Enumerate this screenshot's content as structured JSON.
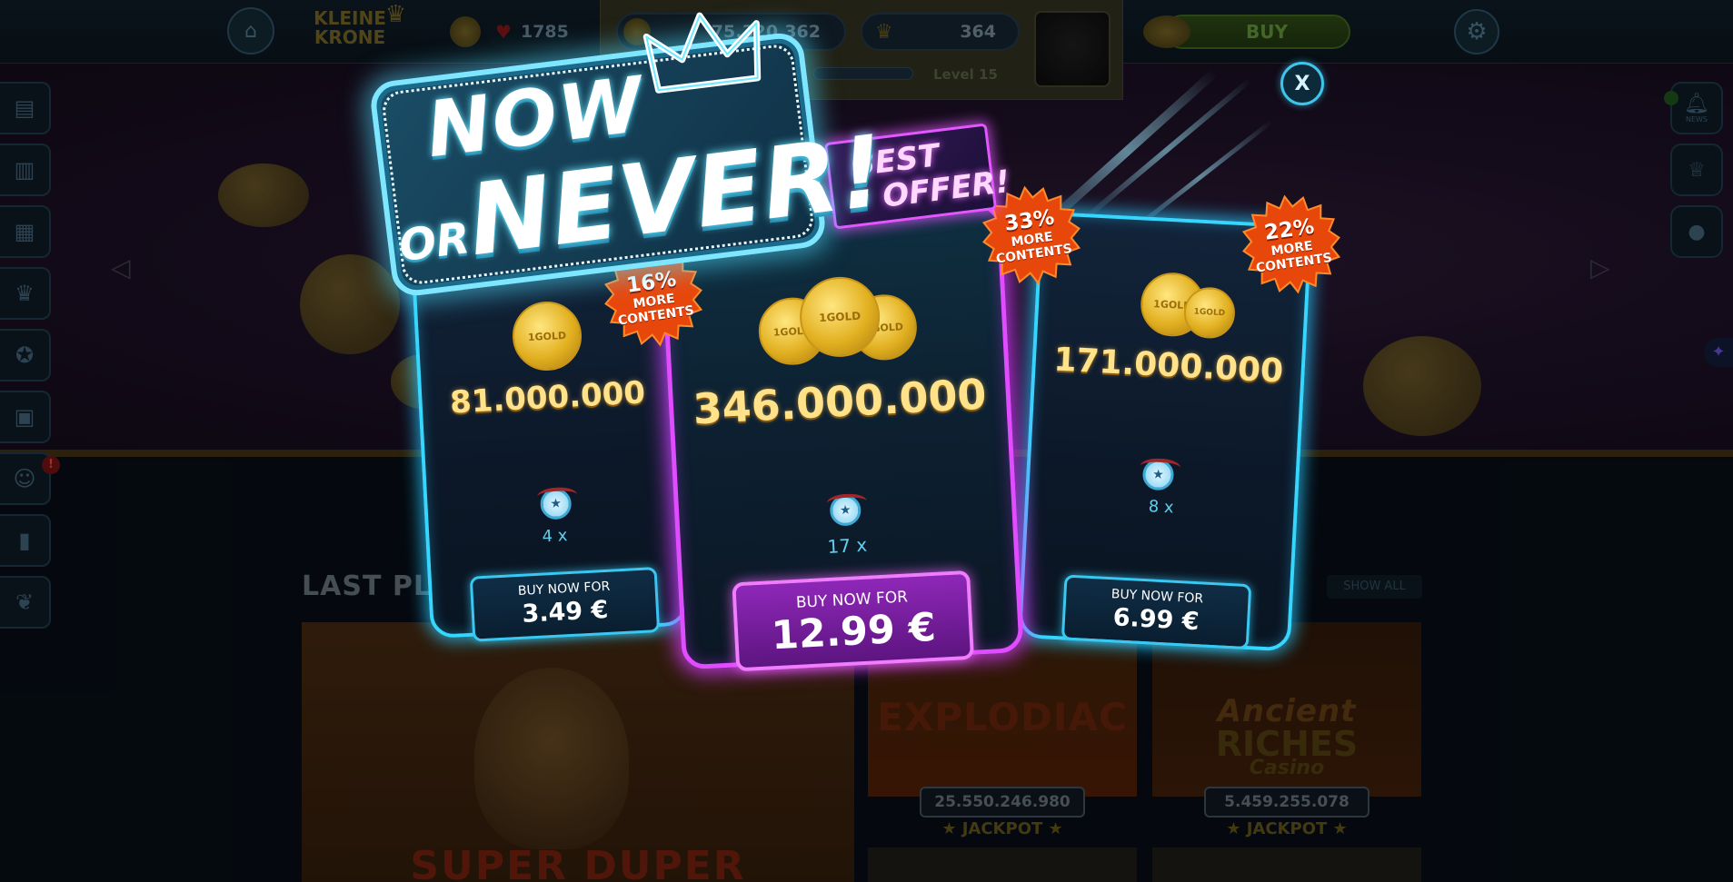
{
  "topbar": {
    "logo_line1": "KLEINE",
    "logo_line2": "KRONE",
    "hearts": "1785",
    "coins": "75.320.362",
    "crowns": "364",
    "level": "Level 15",
    "buy_label": "BUY"
  },
  "right_bar": {
    "news_label": "NEWS"
  },
  "alert_badge": "!",
  "lobby": {
    "section_title": "LAST PLA",
    "show_all": "SHOW ALL",
    "games": [
      {
        "title": "SUPER DUPER"
      },
      {
        "title": "EXPLODIAC",
        "jackpot_value": "25.550.246.980",
        "jackpot_label": "★ JACKPOT ★"
      },
      {
        "title": "Ancient",
        "subtitle": "RICHES",
        "sub2": "Casino",
        "jackpot_value": "5.459.255.078",
        "jackpot_label": "★ JACKPOT ★"
      }
    ]
  },
  "offer": {
    "headline_now": "NOW",
    "headline_or": "OR",
    "headline_never": "NEVER!",
    "best_offer_1": "BEST",
    "best_offer_2": "OFFER!",
    "coin_mark": "1GOLD",
    "close_label": "X",
    "packages": [
      {
        "amount": "81.000.000",
        "bonus_pct": "16%",
        "bonus_text1": "MORE",
        "bonus_text2": "CONTENTS",
        "medal_count": "4 x",
        "buy_caption": "BUY NOW FOR",
        "price": "3.49 €"
      },
      {
        "amount": "346.000.000",
        "bonus_pct": "33%",
        "bonus_text1": "MORE",
        "bonus_text2": "CONTENTS",
        "medal_count": "17 x",
        "buy_caption": "BUY NOW FOR",
        "price": "12.99 €"
      },
      {
        "amount": "171.000.000",
        "bonus_pct": "22%",
        "bonus_text1": "MORE",
        "bonus_text2": "CONTENTS",
        "medal_count": "8 x",
        "buy_caption": "BUY NOW FOR",
        "price": "6.99 €"
      }
    ]
  },
  "colors": {
    "cyan_glow": "#36d6ff",
    "magenta_glow": "#e04cff",
    "gold_text": "#ffe28a",
    "burst_orange": "#f25a12"
  },
  "icons": [
    "home-icon",
    "heart-icon",
    "coin-icon",
    "crown-icon",
    "gear-icon",
    "bell-icon",
    "trophy-icon",
    "ball-icon",
    "sparkle-icon",
    "medal-icon",
    "close-icon"
  ]
}
